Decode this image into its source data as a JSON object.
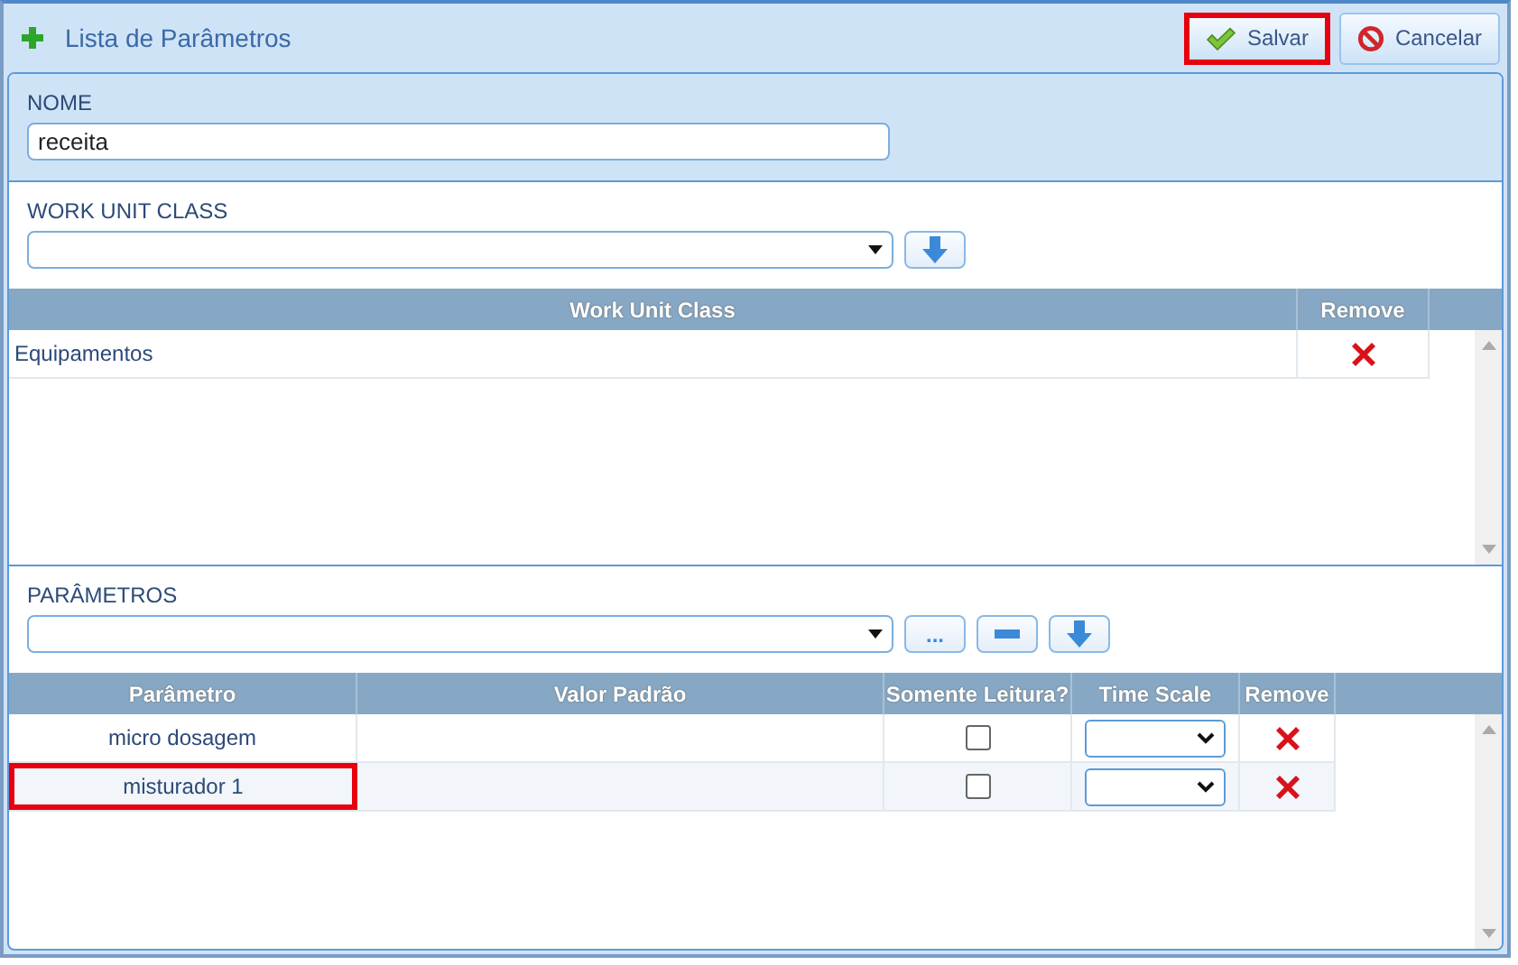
{
  "window": {
    "title": "Lista de Parâmetros"
  },
  "buttons": [
    {
      "label": "Salvar",
      "kind": "save",
      "highlighted": true
    },
    {
      "label": "Cancelar",
      "kind": "cancel",
      "highlighted": false
    }
  ],
  "nome": {
    "label": "NOME",
    "value": "receita"
  },
  "work_unit_class": {
    "label": "WORK UNIT CLASS",
    "columns": [
      "Work Unit Class",
      "Remove"
    ],
    "rows": [
      {
        "name": "Equipamentos"
      }
    ]
  },
  "parametros": {
    "label": "PARÂMETROS",
    "more_button": "...",
    "columns": [
      "Parâmetro",
      "Valor Padrão",
      "Somente Leitura?",
      "Time Scale",
      "Remove"
    ],
    "rows": [
      {
        "name": "micro dosagem",
        "read_only": false,
        "highlighted": false
      },
      {
        "name": "misturador 1",
        "read_only": false,
        "highlighted": true
      }
    ]
  }
}
